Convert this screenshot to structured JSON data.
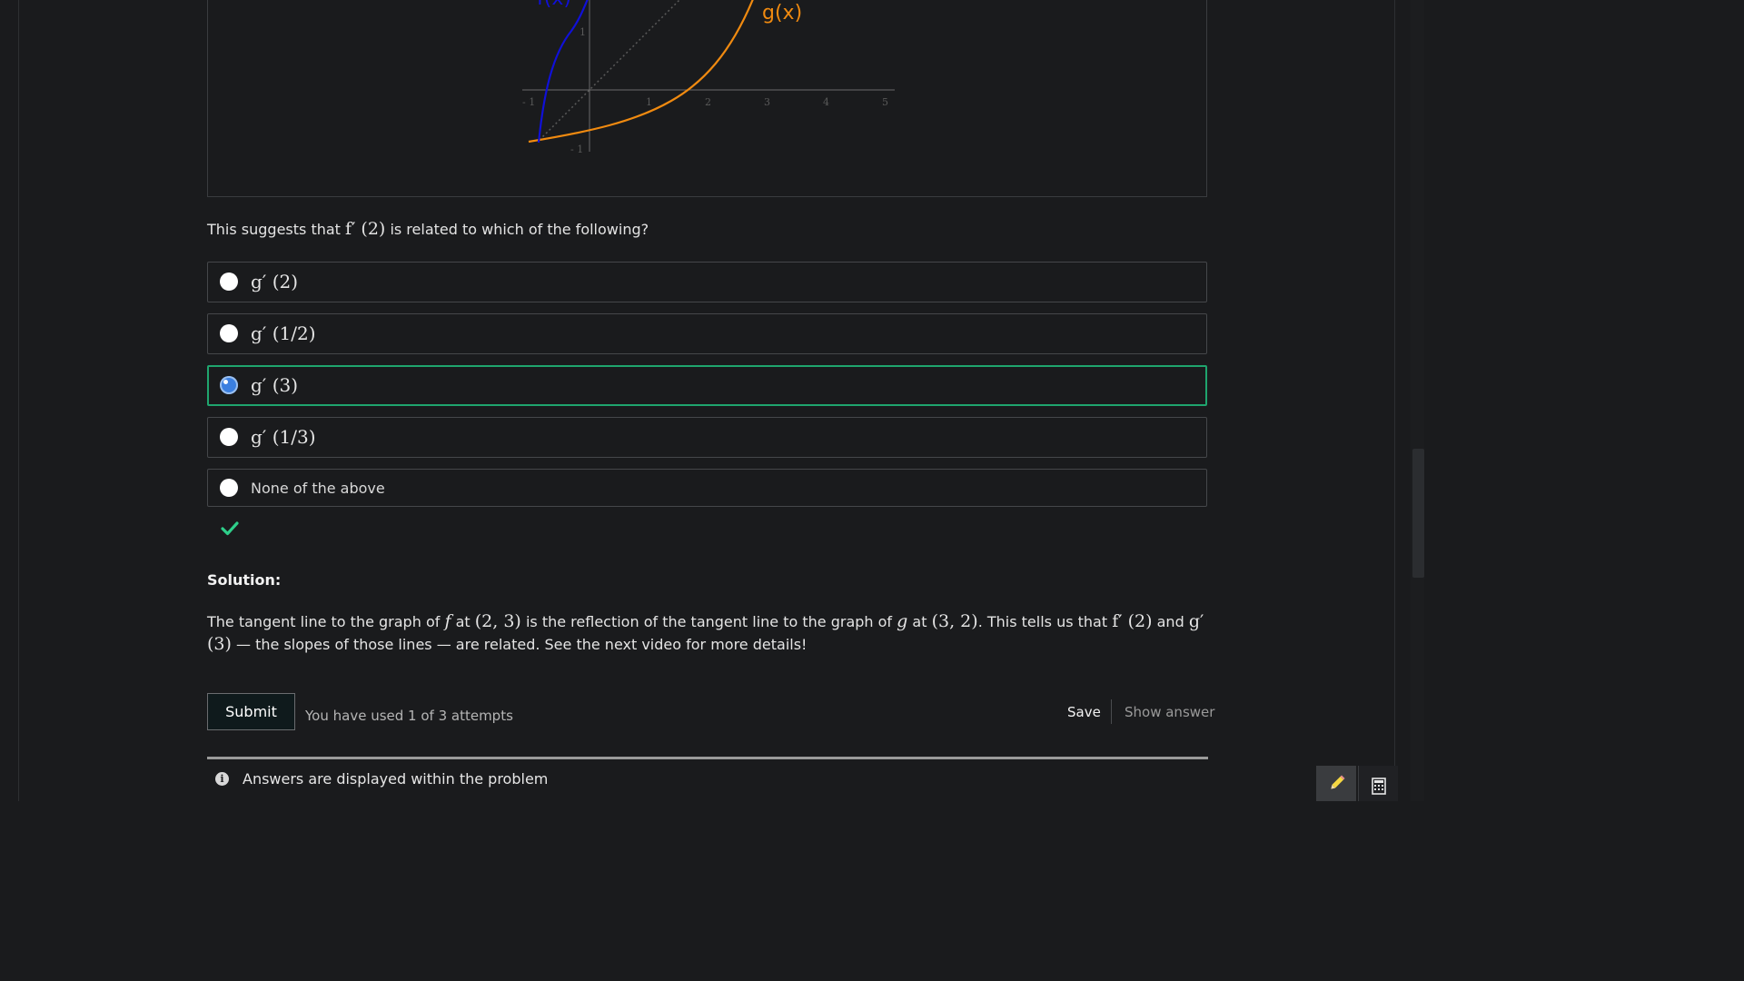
{
  "graph": {
    "curve_labels": {
      "f": "f(x)",
      "g": "g(x)"
    },
    "x_ticks": [
      "- 1",
      "1",
      "2",
      "3",
      "4",
      "5"
    ],
    "y_ticks": [
      "1",
      "- 1"
    ],
    "colors": {
      "f": "#1010d8",
      "g": "#f08a10",
      "axis": "#6a6a6a"
    }
  },
  "question": {
    "prefix": "This suggests that",
    "math": "f′ (2)",
    "suffix": "is related to which of the following?"
  },
  "choices": [
    {
      "label": "g′ (2)",
      "selected": false
    },
    {
      "label": "g′ (1/2)",
      "selected": false
    },
    {
      "label": "g′ (3)",
      "selected": true
    },
    {
      "label": "g′ (1/3)",
      "selected": false
    },
    {
      "label": "None of the above",
      "selected": false
    }
  ],
  "status": {
    "result": "correct",
    "color": "#2ecf8a"
  },
  "solution": {
    "heading": "Solution:",
    "parts": {
      "t1": "The tangent line to the graph of",
      "m1": "f",
      "t2": "at",
      "m2": "(2, 3)",
      "t3": "is the reflection of the tangent line to the graph of",
      "m3": "g",
      "t4": "at",
      "m4": "(3, 2)",
      "t5": ". This tells us that",
      "m5": "f′ (2)",
      "t6": "and",
      "m6": "g′ (3)",
      "t7": "— the slopes of those lines — are related. See the next video for more details!"
    }
  },
  "actions": {
    "submit": "Submit",
    "attempts": "You have used 1 of 3 attempts",
    "save": "Save",
    "show_answer": "Show answer"
  },
  "notice": {
    "icon": "info-icon",
    "text": "Answers are displayed within the problem"
  },
  "tools": [
    {
      "icon": "pencil-icon"
    },
    {
      "icon": "calculator-icon"
    }
  ]
}
